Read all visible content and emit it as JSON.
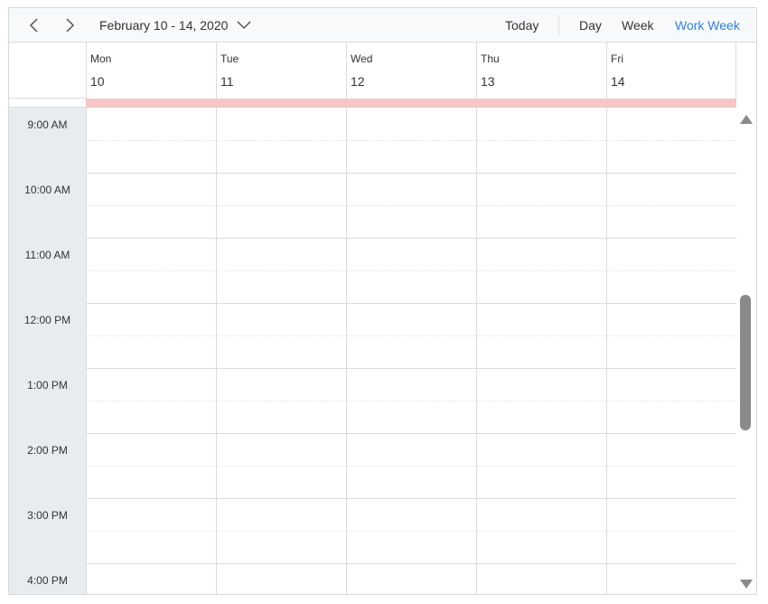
{
  "toolbar": {
    "prev_icon": "chevron-left-icon",
    "next_icon": "chevron-right-icon",
    "date_range": "February 10 - 14, 2020",
    "date_range_icon": "chevron-down-icon",
    "today_label": "Today",
    "views": [
      {
        "label": "Day",
        "active": false
      },
      {
        "label": "Week",
        "active": false
      },
      {
        "label": "Work Week",
        "active": true
      }
    ]
  },
  "days": [
    {
      "name": "Mon",
      "number": "10"
    },
    {
      "name": "Tue",
      "number": "11"
    },
    {
      "name": "Wed",
      "number": "12"
    },
    {
      "name": "Thu",
      "number": "13"
    },
    {
      "name": "Fri",
      "number": "14"
    }
  ],
  "times": [
    "9:00 AM",
    "10:00 AM",
    "11:00 AM",
    "12:00 PM",
    "1:00 PM",
    "2:00 PM",
    "3:00 PM",
    "4:00 PM"
  ],
  "colors": {
    "accent": "#2f7fe0",
    "all_day_band": "#f7c6c6",
    "time_column": "#e9ecef",
    "scroll_thumb": "#8a8a8a"
  }
}
